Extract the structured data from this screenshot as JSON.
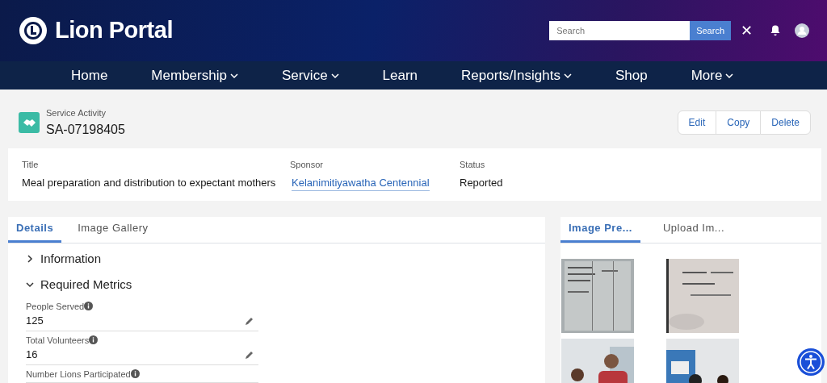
{
  "header": {
    "logo_text": "Lion Portal",
    "search": {
      "placeholder": "Search",
      "button": "Search",
      "clear": "✕"
    }
  },
  "nav": [
    {
      "label": "Home",
      "dropdown": false
    },
    {
      "label": "Membership",
      "dropdown": true
    },
    {
      "label": "Service",
      "dropdown": true
    },
    {
      "label": "Learn",
      "dropdown": false
    },
    {
      "label": "Reports/Insights",
      "dropdown": true
    },
    {
      "label": "Shop",
      "dropdown": false
    },
    {
      "label": "More",
      "dropdown": true
    }
  ],
  "record": {
    "type": "Service Activity",
    "id": "SA-07198405",
    "actions": [
      "Edit",
      "Copy",
      "Delete"
    ]
  },
  "highlights": [
    {
      "label": "Title",
      "value": "Meal preparation and distribution to expectant mothers",
      "kind": "text"
    },
    {
      "label": "Sponsor",
      "value": "Kelanimitiyawatha Centennial",
      "kind": "link"
    },
    {
      "label": "Status",
      "value": "Reported",
      "kind": "text"
    }
  ],
  "detail_tabs": [
    {
      "label": "Details",
      "selected": true
    },
    {
      "label": "Image Gallery",
      "selected": false
    }
  ],
  "sections": [
    {
      "title": "Information",
      "expanded": false
    },
    {
      "title": "Required Metrics",
      "expanded": true
    }
  ],
  "metrics": [
    {
      "label": "People Served",
      "value": "125"
    },
    {
      "label": "Total Volunteers",
      "value": "16"
    },
    {
      "label": "Number Lions Participated"
    }
  ],
  "side_tabs": [
    {
      "label": "Image Pre...",
      "selected": true
    },
    {
      "label": "Upload Im...",
      "selected": false
    }
  ]
}
